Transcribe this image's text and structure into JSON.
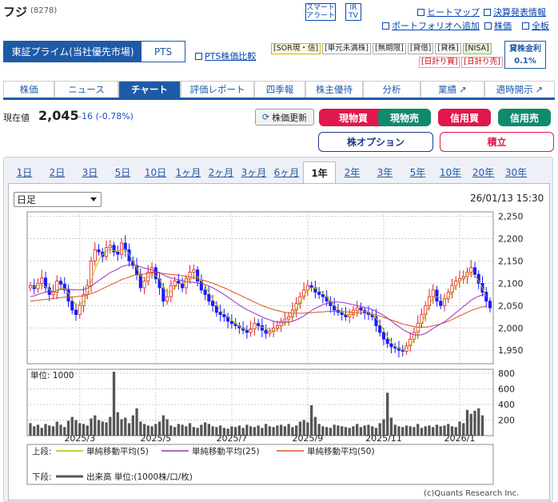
{
  "header": {
    "title": "フジ",
    "code": "(8278)",
    "smart_alert": [
      "スマート",
      "アラート"
    ],
    "ir_tv": [
      "IR",
      "TV"
    ],
    "links": {
      "heatmap": "ヒートマップ",
      "earnings": "決算発表情報",
      "portfolio": "ポートフォリオへ追加",
      "stocks": "株価",
      "board": "全板"
    }
  },
  "market": {
    "active": "東証プライム(当社優先市場)",
    "pts": "PTS",
    "pts_compare": "PTS株価比較"
  },
  "tags": {
    "row1": [
      "[SOR現・信]",
      "[単元未満株]",
      "[無期限]",
      "[貸借]",
      "[貸株]",
      "[NISA]"
    ],
    "row2": [
      "[日計り買]",
      "[日計り売]"
    ]
  },
  "rate": {
    "label": "貸株金利",
    "value": "0.1%"
  },
  "tabs": [
    "株価",
    "ニュース",
    "チャート",
    "評価レポート",
    "四季報",
    "株主優待",
    "分析",
    "業績",
    "適時開示"
  ],
  "price": {
    "label": "現在値",
    "value": "2,045",
    "change": "-16 (-0.78%)",
    "refresh": "株価更新"
  },
  "buttons": {
    "spot_buy": "現物買",
    "spot_sell": "現物売",
    "margin_buy": "信用買",
    "margin_sell": "信用売",
    "options": "株オプション",
    "accumulate": "積立"
  },
  "period_tabs": [
    "1日",
    "2日",
    "3日",
    "5日",
    "10日",
    "1ヶ月",
    "2ヶ月",
    "3ヶ月",
    "6ヶ月",
    "1年",
    "2年",
    "3年",
    "5年",
    "10年",
    "20年",
    "30年"
  ],
  "active_period": "1年",
  "chart": {
    "select_value": "日足",
    "timestamp": "26/01/13 15:30",
    "volume_unit_label": "単位: 1000",
    "credit": "(c)Quants Research Inc.",
    "legend": {
      "upper_label": "上段:",
      "lower_label": "下段:",
      "ma5": "単純移動平均(5)",
      "ma25": "単純移動平均(25)",
      "ma50": "単純移動平均(50)",
      "volume": "出来高 単位:(1000株/口/枚)"
    },
    "colors": {
      "ma5": "#b5c000",
      "ma25": "#9a2fc4",
      "ma50": "#e0501e",
      "up": "#e02020",
      "down": "#1a1aff",
      "volume": "#555555"
    }
  },
  "chart_data": {
    "type": "candlestick",
    "x_ticks": [
      "2025/3",
      "2025/5",
      "2025/7",
      "2025/9",
      "2025/11",
      "2026/1"
    ],
    "y_ticks": [
      1950,
      2000,
      2050,
      2100,
      2150,
      2200,
      2250
    ],
    "ylim": [
      1920,
      2260
    ],
    "volume_ticks": [
      200,
      400,
      600,
      800
    ],
    "volume_ylim": [
      0,
      850
    ],
    "close_series": [
      2095,
      2088,
      2100,
      2112,
      2090,
      2075,
      2080,
      2105,
      2098,
      2085,
      2060,
      2040,
      2030,
      2050,
      2075,
      2095,
      2150,
      2175,
      2170,
      2160,
      2180,
      2185,
      2170,
      2165,
      2190,
      2175,
      2150,
      2140,
      2120,
      2090,
      2105,
      2125,
      2135,
      2110,
      2090,
      2060,
      2070,
      2095,
      2105,
      2100,
      2090,
      2110,
      2125,
      2130,
      2105,
      2085,
      2075,
      2060,
      2050,
      2035,
      2030,
      2025,
      2015,
      2010,
      2005,
      2000,
      1995,
      1990,
      1998,
      2010,
      2005,
      1995,
      1988,
      1992,
      2000,
      2005,
      2015,
      2020,
      2025,
      2040,
      2055,
      2070,
      2085,
      2095,
      2090,
      2080,
      2075,
      2070,
      2060,
      2050,
      2040,
      2035,
      2030,
      2025,
      2030,
      2040,
      2045,
      2040,
      2035,
      2030,
      2025,
      2005,
      1990,
      1975,
      1965,
      1958,
      1955,
      1950,
      1948,
      1960,
      1975,
      1990,
      2010,
      2030,
      2050,
      2070,
      2085,
      2060,
      2050,
      2065,
      2080,
      2095,
      2105,
      2110,
      2115,
      2125,
      2135,
      2120,
      2100,
      2080,
      2060,
      2045
    ],
    "ma5": [
      2090,
      2092,
      2095,
      2097,
      2093,
      2086,
      2082,
      2085,
      2090,
      2088,
      2078,
      2063,
      2053,
      2052,
      2058,
      2076,
      2105,
      2132,
      2150,
      2165,
      2172,
      2176,
      2173,
      2171,
      2176,
      2176,
      2165,
      2150,
      2135,
      2118,
      2110,
      2114,
      2118,
      2117,
      2110,
      2090,
      2080,
      2082,
      2090,
      2098,
      2100,
      2103,
      2110,
      2116,
      2115,
      2106,
      2095,
      2080,
      2065,
      2051,
      2041,
      2033,
      2025,
      2018,
      2010,
      2004,
      1999,
      1996,
      1996,
      1999,
      2002,
      2002,
      1999,
      1996,
      1995,
      1997,
      2002,
      2010,
      2017,
      2028,
      2043,
      2058,
      2072,
      2085,
      2090,
      2089,
      2084,
      2077,
      2070,
      2061,
      2051,
      2042,
      2036,
      2030,
      2030,
      2033,
      2036,
      2038,
      2038,
      2036,
      2031,
      2022,
      2010,
      1995,
      1981,
      1968,
      1959,
      1954,
      1952,
      1955,
      1962,
      1973,
      1990,
      2010,
      2030,
      2050,
      2068,
      2070,
      2068,
      2064,
      2068,
      2080,
      2094,
      2104,
      2112,
      2120,
      2122,
      2118,
      2106,
      2090,
      2070
    ],
    "ma25": [
      2070,
      2072,
      2075,
      2078,
      2080,
      2081,
      2082,
      2084,
      2086,
      2087,
      2087,
      2086,
      2085,
      2085,
      2086,
      2089,
      2094,
      2100,
      2106,
      2112,
      2118,
      2124,
      2128,
      2132,
      2137,
      2140,
      2141,
      2141,
      2140,
      2137,
      2134,
      2132,
      2130,
      2127,
      2124,
      2119,
      2115,
      2112,
      2110,
      2108,
      2106,
      2104,
      2103,
      2102,
      2101,
      2099,
      2097,
      2094,
      2090,
      2085,
      2080,
      2075,
      2069,
      2063,
      2057,
      2051,
      2046,
      2041,
      2037,
      2033,
      2029,
      2025,
      2021,
      2018,
      2015,
      2013,
      2012,
      2012,
      2013,
      2015,
      2018,
      2022,
      2027,
      2033,
      2039,
      2044,
      2048,
      2052,
      2055,
      2057,
      2058,
      2058,
      2057,
      2056,
      2054,
      2052,
      2050,
      2048,
      2046,
      2044,
      2041,
      2037,
      2033,
      2028,
      2022,
      2016,
      2009,
      2003,
      1997,
      1992,
      1988,
      1985,
      1984,
      1985,
      1988,
      1993,
      1999,
      2004,
      2009,
      2014,
      2020,
      2027,
      2034,
      2041,
      2048,
      2055,
      2062,
      2067,
      2071,
      2074,
      2075
    ],
    "ma50": [
      2060,
      2061,
      2062,
      2063,
      2064,
      2065,
      2066,
      2067,
      2068,
      2069,
      2069,
      2070,
      2070,
      2071,
      2072,
      2074,
      2077,
      2080,
      2084,
      2088,
      2092,
      2096,
      2100,
      2104,
      2108,
      2111,
      2114,
      2117,
      2119,
      2120,
      2121,
      2122,
      2123,
      2123,
      2123,
      2122,
      2121,
      2120,
      2119,
      2118,
      2117,
      2115,
      2114,
      2112,
      2110,
      2108,
      2106,
      2103,
      2100,
      2097,
      2093,
      2090,
      2086,
      2082,
      2078,
      2074,
      2070,
      2066,
      2062,
      2058,
      2054,
      2050,
      2047,
      2044,
      2041,
      2039,
      2037,
      2035,
      2034,
      2033,
      2033,
      2033,
      2033,
      2034,
      2034,
      2035,
      2036,
      2036,
      2037,
      2037,
      2037,
      2037,
      2037,
      2036,
      2036,
      2035,
      2034,
      2034,
      2033,
      2032,
      2031,
      2029,
      2027,
      2024,
      2021,
      2018,
      2015,
      2012,
      2009,
      2007,
      2005,
      2003,
      2002,
      2002,
      2002,
      2003,
      2005,
      2007,
      2009,
      2012,
      2015,
      2019,
      2023,
      2027,
      2031,
      2035,
      2039,
      2042,
      2045,
      2047,
      2048
    ],
    "volume_series": [
      160,
      120,
      140,
      100,
      150,
      130,
      120,
      180,
      140,
      110,
      190,
      240,
      200,
      160,
      150,
      130,
      220,
      260,
      200,
      180,
      170,
      240,
      820,
      300,
      210,
      230,
      160,
      260,
      350,
      180,
      150,
      130,
      120,
      150,
      180,
      260,
      210,
      130,
      110,
      150,
      140,
      120,
      160,
      110,
      100,
      140,
      170,
      150,
      120,
      110,
      130,
      100,
      90,
      120,
      110,
      130,
      100,
      140,
      120,
      110,
      130,
      100,
      150,
      120,
      110,
      130,
      140,
      120,
      150,
      110,
      130,
      180,
      200,
      170,
      390,
      240,
      150,
      120,
      110,
      100,
      140,
      130,
      120,
      110,
      100,
      120,
      150,
      110,
      130,
      140,
      120,
      100,
      160,
      210,
      550,
      230,
      140,
      120,
      110,
      130,
      120,
      110,
      150,
      100,
      120,
      130,
      110,
      140,
      120,
      130,
      150,
      120,
      110,
      180,
      160,
      330,
      280,
      320,
      350,
      260
    ]
  }
}
